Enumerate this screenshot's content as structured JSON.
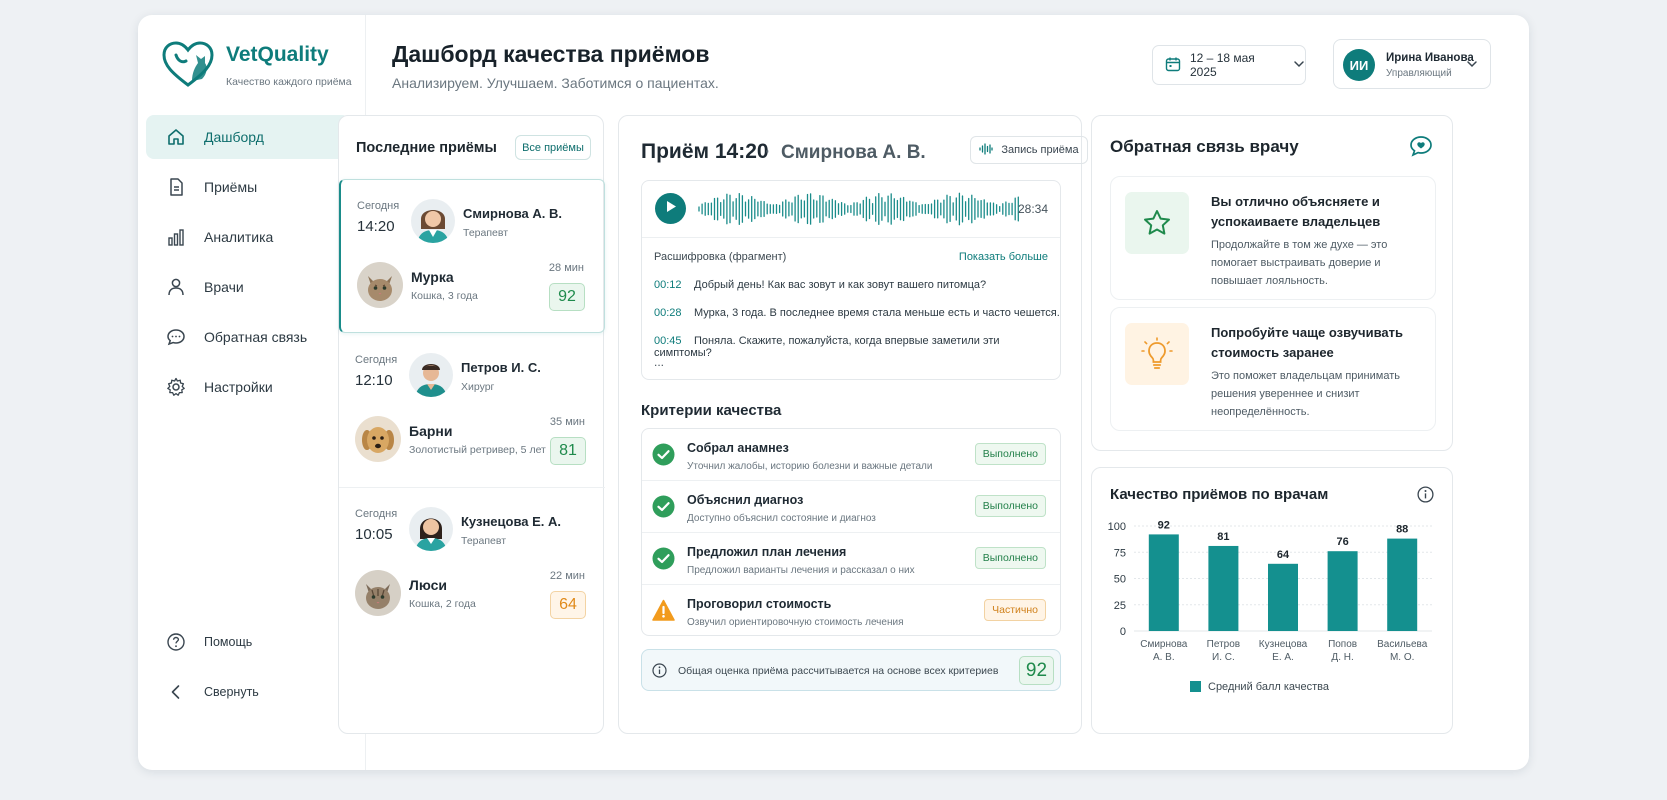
{
  "brand": {
    "name": "VetQuality",
    "tagline": "Качество каждого приёма"
  },
  "nav": {
    "items": [
      {
        "label": "Дашборд",
        "icon": "home-icon",
        "active": true
      },
      {
        "label": "Приёмы",
        "icon": "document-icon"
      },
      {
        "label": "Аналитика",
        "icon": "bar-chart-icon"
      },
      {
        "label": "Врачи",
        "icon": "user-icon"
      },
      {
        "label": "Обратная связь",
        "icon": "chat-icon"
      },
      {
        "label": "Настройки",
        "icon": "gear-icon"
      }
    ],
    "bottom": [
      {
        "label": "Помощь",
        "icon": "help-icon"
      },
      {
        "label": "Свернуть",
        "icon": "chevron-left-icon"
      }
    ]
  },
  "header": {
    "title": "Дашборд качества приёмов",
    "subtitle": "Анализируем. Улучшаем. Заботимся о пациентах.",
    "date_range": "12 – 18 мая 2025",
    "user": {
      "initials": "ИИ",
      "name": "Ирина Иванова",
      "role": "Управляющий"
    }
  },
  "recent": {
    "title": "Последние приёмы",
    "all_button": "Все приёмы",
    "items": [
      {
        "day": "Сегодня",
        "time": "14:20",
        "doctor": "Смирнова А. В.",
        "doctor_role": "Терапевт",
        "pet": "Мурка",
        "pet_desc": "Кошка, 3 года",
        "duration": "28 мин",
        "score": "92",
        "score_level": "good"
      },
      {
        "day": "Сегодня",
        "time": "12:10",
        "doctor": "Петров И. С.",
        "doctor_role": "Хирург",
        "pet": "Барни",
        "pet_desc": "Золотистый ретривер, 5 лет",
        "duration": "35 мин",
        "score": "81",
        "score_level": "good"
      },
      {
        "day": "Сегодня",
        "time": "10:05",
        "doctor": "Кузнецова Е. А.",
        "doctor_role": "Терапевт",
        "pet": "Люси",
        "pet_desc": "Кошка, 2 года",
        "duration": "22 мин",
        "score": "64",
        "score_level": "warn"
      }
    ]
  },
  "appointment": {
    "time_title": "Приём 14:20",
    "separator": "·",
    "doctor": "Смирнова А. В.",
    "record_button": "Запись приёма",
    "duration": "28:34",
    "transcript_label": "Расшифровка (фрагмент)",
    "show_more": "Показать больше",
    "transcript": [
      {
        "ts": "00:12",
        "text": "Добрый день! Как вас зовут и как зовут вашего питомца?"
      },
      {
        "ts": "00:28",
        "text": "Мурка, 3 года. В последнее время стала меньше есть и часто чешется."
      },
      {
        "ts": "00:45",
        "text": "Поняла. Скажите, пожалуйста, когда впервые заметили эти симптомы?"
      }
    ],
    "ellipsis": "...",
    "criteria_title": "Критерии качества",
    "criteria": [
      {
        "name": "Собрал анамнез",
        "desc": "Уточнил жалобы, историю болезни и важные детали",
        "status": "Выполнено",
        "state": "ok"
      },
      {
        "name": "Объяснил диагноз",
        "desc": "Доступно объяснил состояние и диагноз",
        "status": "Выполнено",
        "state": "ok"
      },
      {
        "name": "Предложил план лечения",
        "desc": "Предложил варианты лечения и рассказал о них",
        "status": "Выполнено",
        "state": "ok"
      },
      {
        "name": "Проговорил стоимость",
        "desc": "Озвучил ориентировочную стоимость лечения",
        "status": "Частично",
        "state": "partial"
      }
    ],
    "total_note": "Общая оценка приёма рассчитывается на основе всех критериев",
    "total_score": "92"
  },
  "feedback": {
    "title": "Обратная связь врачу",
    "cards": [
      {
        "title": "Вы отлично объясняете и успокаиваете владельцев",
        "text": "Продолжайте в том же духе — это помогает выстраивать доверие и повышает лояльность.",
        "icon": "star-icon"
      },
      {
        "title": "Попробуйте чаще озвучивать стоимость заранее",
        "text": "Это поможет владельцам принимать решения увереннее и снизит неопределённость.",
        "icon": "lightbulb-icon"
      }
    ]
  },
  "chart_data": {
    "type": "bar",
    "title": "Качество приёмов по врачам",
    "categories": [
      "Смирнова А. В.",
      "Петров И. С.",
      "Кузнецова Е. А.",
      "Попов Д. Н.",
      "Васильева М. О."
    ],
    "category_lines": [
      [
        "Смирнова",
        "А. В."
      ],
      [
        "Петров",
        "И. С."
      ],
      [
        "Кузнецова",
        "Е. А."
      ],
      [
        "Попов",
        "Д. Н."
      ],
      [
        "Васильева",
        "М. О."
      ]
    ],
    "series": [
      {
        "name": "Средний балл качества",
        "values": [
          92,
          81,
          64,
          76,
          88
        ]
      }
    ],
    "ylim": [
      0,
      100
    ],
    "yticks": [
      0,
      25,
      50,
      75,
      100
    ],
    "grid": true,
    "legend": "bottom",
    "color": "#14908f"
  },
  "colors": {
    "accent": "#0e7c7b",
    "good": "#1f8a4c",
    "warn": "#e08a1a"
  }
}
